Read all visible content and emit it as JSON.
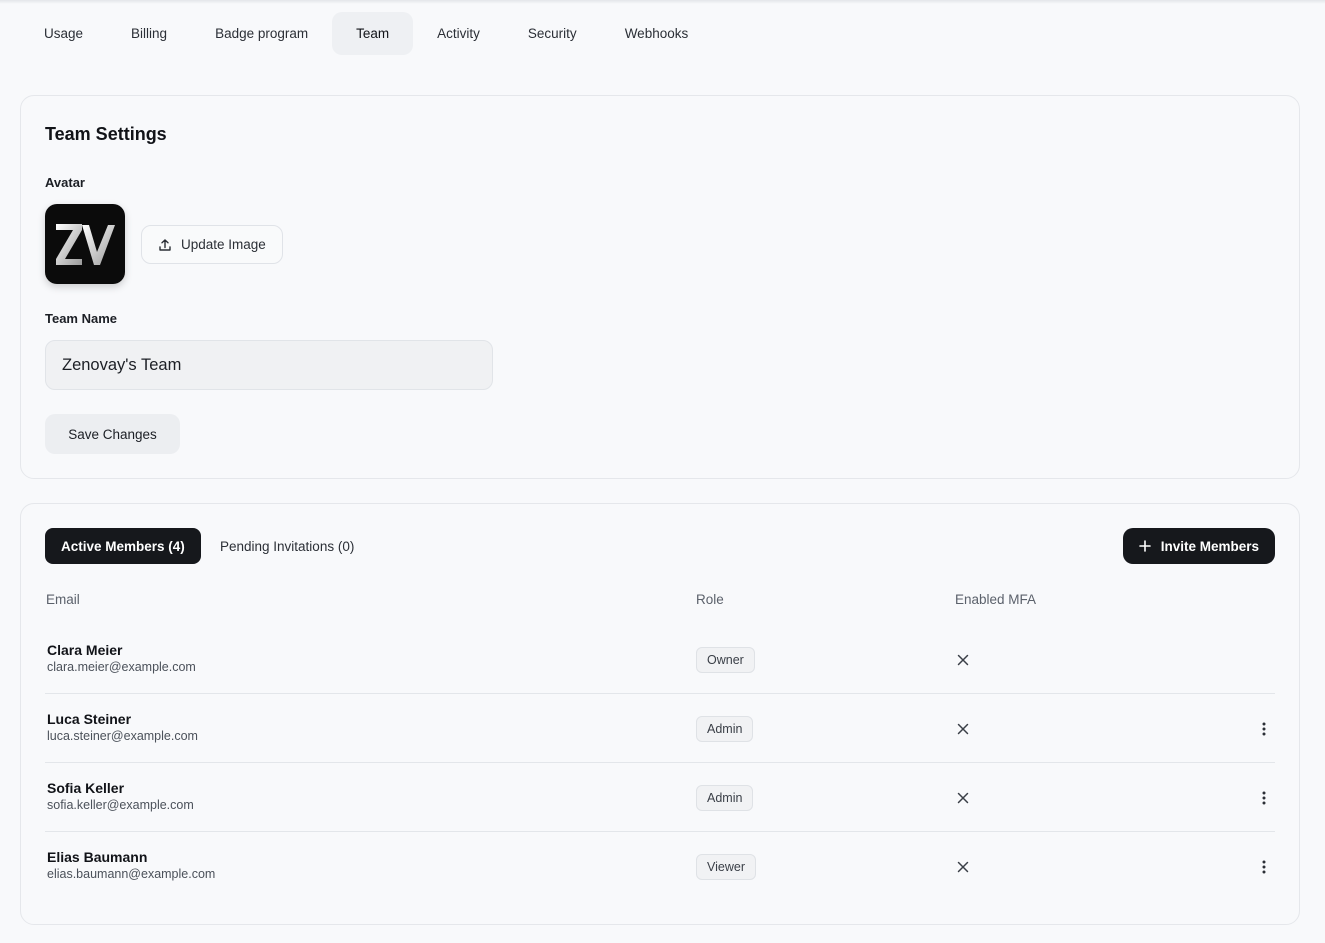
{
  "nav_tabs": [
    {
      "label": "Usage"
    },
    {
      "label": "Billing"
    },
    {
      "label": "Badge program"
    },
    {
      "label": "Team",
      "active": true
    },
    {
      "label": "Activity"
    },
    {
      "label": "Security"
    },
    {
      "label": "Webhooks"
    }
  ],
  "settings": {
    "title": "Team Settings",
    "avatar_label": "Avatar",
    "avatar_logo_text": "ZV",
    "update_image_label": "Update Image",
    "team_name_label": "Team Name",
    "team_name_value": "Zenovay's Team",
    "save_label": "Save Changes"
  },
  "members": {
    "active_tab_label": "Active Members (4)",
    "pending_tab_label": "Pending Invitations (0)",
    "invite_label": "Invite Members",
    "columns": {
      "email": "Email",
      "role": "Role",
      "mfa": "Enabled MFA"
    },
    "rows": [
      {
        "name": "Clara Meier",
        "email": "clara.meier@example.com",
        "role": "Owner",
        "mfa_enabled": false,
        "has_menu": false
      },
      {
        "name": "Luca Steiner",
        "email": "luca.steiner@example.com",
        "role": "Admin",
        "mfa_enabled": false,
        "has_menu": true
      },
      {
        "name": "Sofia Keller",
        "email": "sofia.keller@example.com",
        "role": "Admin",
        "mfa_enabled": false,
        "has_menu": true
      },
      {
        "name": "Elias Baumann",
        "email": "elias.baumann@example.com",
        "role": "Viewer",
        "mfa_enabled": false,
        "has_menu": true
      }
    ]
  },
  "icons": {
    "upload": "upload-icon",
    "plus": "plus-icon",
    "mfa_disabled": "x-icon",
    "row_menu": "more-vertical-icon"
  },
  "colors": {
    "background": "#f8f9fb",
    "primary_button": "#16181c",
    "border": "#e5e7eb",
    "muted_text": "#5b616b"
  }
}
